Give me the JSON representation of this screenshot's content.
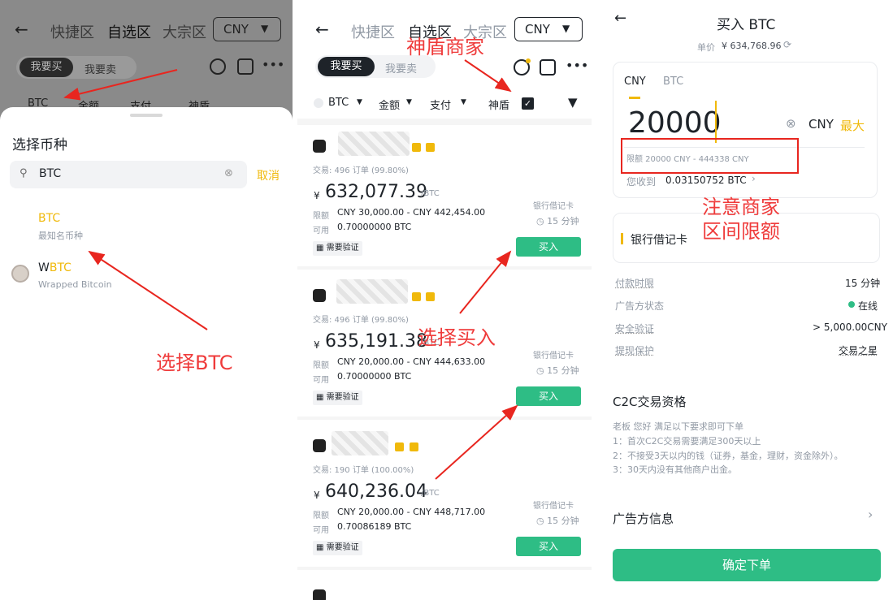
{
  "panel1": {
    "header": {
      "back": "←",
      "tab1": "快捷区",
      "tab2": "自选区",
      "tab3": "大宗区",
      "currency": "CNY"
    },
    "seg": {
      "buy": "我要买",
      "sell": "我要卖"
    },
    "filters": {
      "coin": "BTC",
      "amount": "金额",
      "pay": "支付",
      "shield": "神盾"
    },
    "sheet": {
      "title": "选择币种",
      "search_value": "BTC",
      "cancel": "取消",
      "items": [
        {
          "name": "BTC",
          "sub": "最知名币种"
        },
        {
          "name_prefix": "W",
          "name_hl": "BTC",
          "sub": "Wrapped Bitcoin"
        }
      ]
    },
    "annotation": "选择BTC"
  },
  "panel2": {
    "header": {
      "back": "←",
      "tab1": "快捷区",
      "tab2": "自选区",
      "tab3": "大宗区",
      "currency": "CNY"
    },
    "seg": {
      "buy": "我要买",
      "sell": "我要卖"
    },
    "filters": {
      "coin": "BTC",
      "amount": "金额",
      "pay": "支付",
      "shield": "神盾"
    },
    "ads": [
      {
        "trades": "交易: 496 订单 (99.80%)",
        "currency_sym": "¥",
        "price": "632,077.39",
        "unit": "/BTC",
        "limit_label": "限额",
        "limit": "CNY 30,000.00 - CNY 442,454.00",
        "avail_label": "可用",
        "avail": "0.70000000 BTC",
        "pay": "银行借记卡",
        "time": "15 分钟",
        "buy": "买入",
        "verify": "需要验证"
      },
      {
        "trades": "交易: 496 订单 (99.80%)",
        "currency_sym": "¥",
        "price": "635,191.38",
        "unit": "/BTC",
        "limit_label": "限额",
        "limit": "CNY 20,000.00 - CNY 444,633.00",
        "avail_label": "可用",
        "avail": "0.70000000 BTC",
        "pay": "银行借记卡",
        "time": "15 分钟",
        "buy": "买入",
        "verify": "需要验证"
      },
      {
        "trades": "交易: 190 订单 (100.00%)",
        "currency_sym": "¥",
        "price": "640,236.04",
        "unit": "/BTC",
        "limit_label": "限额",
        "limit": "CNY 20,000.00 - CNY 448,717.00",
        "avail_label": "可用",
        "avail": "0.70086189 BTC",
        "pay": "银行借记卡",
        "time": "15 分钟",
        "buy": "买入",
        "verify": "需要验证"
      }
    ],
    "annotation_shield": "神盾商家",
    "annotation_buy": "选择买入"
  },
  "panel3": {
    "back": "←",
    "title": "买入 BTC",
    "unit_price_label": "单价",
    "unit_price": "¥ 634,768.96",
    "tab_cny": "CNY",
    "tab_btc": "BTC",
    "amount": "20000",
    "amount_cur": "CNY",
    "max": "最大",
    "limit_text": "限额 20000 CNY - 444338 CNY",
    "receive_label": "您收到",
    "receive_value": "0.03150752 BTC",
    "pay_method": "银行借记卡",
    "annotation": "注意商家\n区间限额",
    "rows": [
      {
        "label": "付款时限",
        "value": "15 分钟"
      },
      {
        "label": "广告方状态",
        "value": "在线"
      },
      {
        "label": "安全验证",
        "value": "> 5,000.00CNY"
      },
      {
        "label": "提现保护",
        "value": "交易之星"
      }
    ],
    "qual_title": "C2C交易资格",
    "qual_lines": [
      "老板 您好 满足以下要求即可下单",
      "1：首次C2C交易需要满足300天以上",
      "2：不接受3天以内的钱（证券，基金，理财，资金除外）。",
      "3：30天内没有其他商户出金。"
    ],
    "adv_info": "广告方信息",
    "confirm": "确定下单"
  }
}
